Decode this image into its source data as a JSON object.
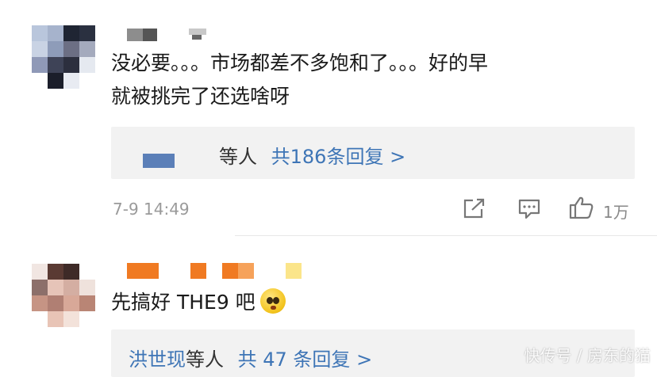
{
  "comments": [
    {
      "text_line1": "没必要。。。市场都差不多饱和了。。。好的早",
      "text_line2": "就被挑完了还选啥呀",
      "replies_prefix": "等人",
      "replies_count": "共186条回复 >",
      "time": "7-9 14:49",
      "likes": "1万"
    },
    {
      "text": "先搞好 THE9 吧",
      "replies_names": "洪世现",
      "replies_prefix": "等人",
      "replies_count": "共 47 条回复 >"
    }
  ],
  "watermark": "快传号 / 房东的猫",
  "icons": {
    "share": "share-icon",
    "comment": "comment-icon",
    "like": "thumbs-up-icon",
    "emoji": "crying-face-emoji"
  }
}
